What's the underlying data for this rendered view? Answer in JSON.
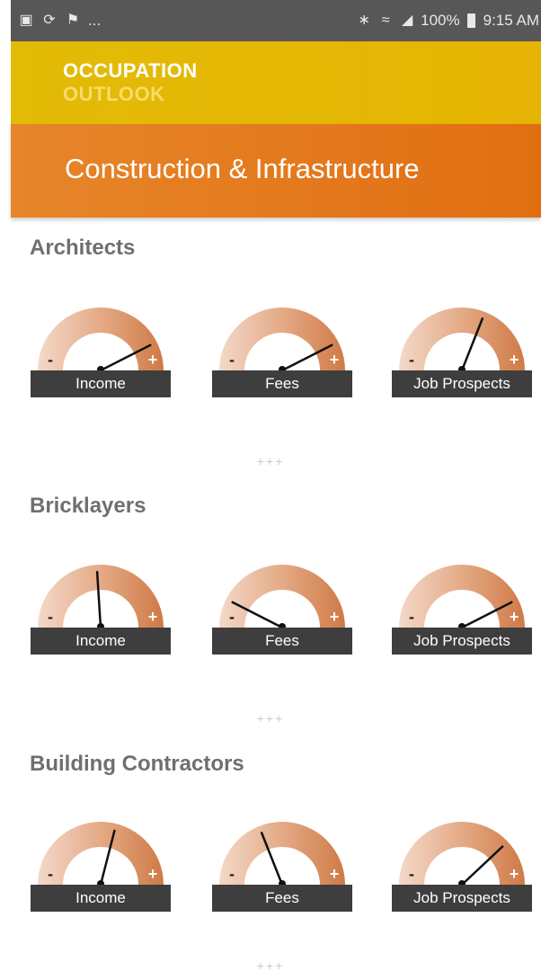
{
  "status_bar": {
    "left_icons": [
      "picture-icon",
      "sync-icon",
      "flag-icon"
    ],
    "left_more": "...",
    "right_text": "100%",
    "time": "9:15 AM",
    "right_icons": [
      "bluetooth-icon",
      "wifi-icon",
      "signal-icon",
      "battery-icon"
    ]
  },
  "header": {
    "title_line1": "OCCUPATION",
    "title_line2": "OUTLOOK",
    "color": "#e2bb06"
  },
  "category": {
    "label": "Construction & Infrastructure",
    "color": "#e37a1c"
  },
  "gauge_scale": {
    "minus": "-",
    "plus": "+"
  },
  "occupations": [
    {
      "name": "Architects",
      "gauges": [
        {
          "label": "Income",
          "level": 0.85
        },
        {
          "label": "Fees",
          "level": 0.85
        },
        {
          "label": "Job Prospects",
          "level": 0.62
        }
      ]
    },
    {
      "name": "Bricklayers",
      "gauges": [
        {
          "label": "Income",
          "level": 0.48
        },
        {
          "label": "Fees",
          "level": 0.15
        },
        {
          "label": "Job Prospects",
          "level": 0.85
        }
      ]
    },
    {
      "name": "Building Contractors",
      "gauges": [
        {
          "label": "Income",
          "level": 0.58
        },
        {
          "label": "Fees",
          "level": 0.38
        },
        {
          "label": "Job Prospects",
          "level": 0.76
        }
      ]
    }
  ],
  "separators": [
    "+++",
    "+++",
    "+++"
  ],
  "colors": {
    "gauge_dark": "#cf7a46",
    "gauge_light": "#f4d9c9",
    "gauge_label_bg": "#3e3e3e",
    "needle": "#111111"
  }
}
